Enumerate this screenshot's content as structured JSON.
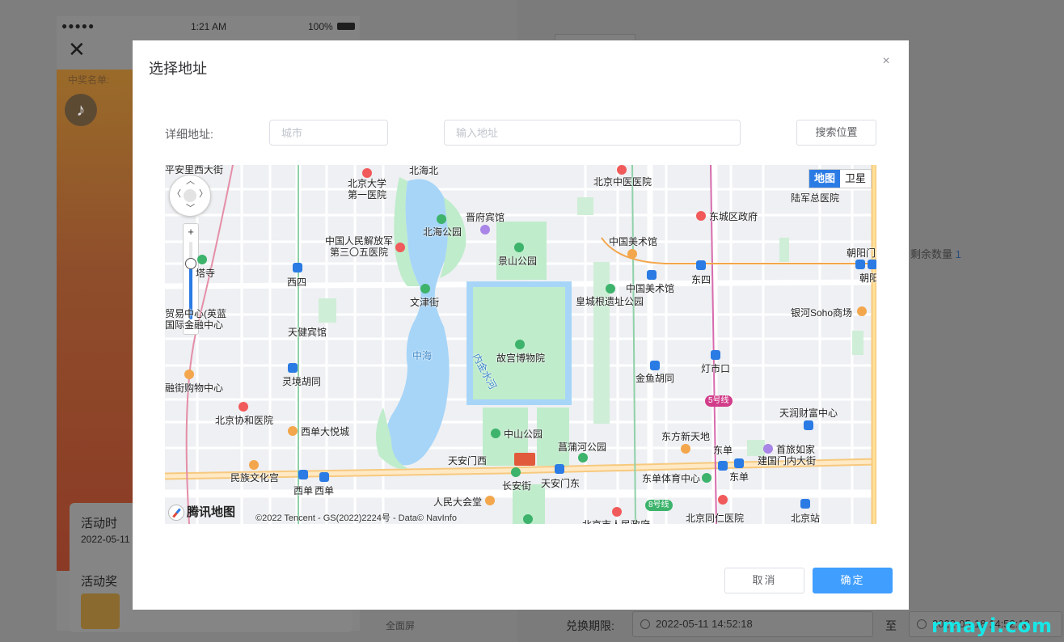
{
  "background": {
    "phone": {
      "signal": "●●●●●",
      "time": "1:21 AM",
      "battery": "100%",
      "notice": "中奖名单:",
      "card": {
        "activity_time_label": "活动时",
        "activity_time_value": "2022-05-11",
        "activity_prize_label": "活动奖"
      }
    },
    "fullscreen_label": "全面屏",
    "remaining_label": "剩余数量",
    "remaining_value": "1",
    "exchange_label": "兑换期限:",
    "exchange_start": "2022-05-11 14:52:18",
    "exchange_to": "至",
    "exchange_end": "2022-05-18 14:52:18",
    "watermark": "rmayi.com"
  },
  "dialog": {
    "title": "选择地址",
    "close_icon": "×",
    "address_label": "详细地址:",
    "city_placeholder": "城市",
    "address_placeholder": "输入地址",
    "search_button": "搜索位置",
    "cancel_button": "取消",
    "ok_button": "确定"
  },
  "map": {
    "toggle_map": "地图",
    "toggle_satellite": "卫星",
    "zoom_in": "+",
    "zoom_out": "−",
    "zoom_level": 0.72,
    "logo": "腾讯地图",
    "copyright": "©2022 Tencent - GS(2022)2224号 - Data© NavInfo",
    "places": {
      "pingan_li": "平安里西大街",
      "beida_hospital": "北京大学\n第一医院",
      "beihai_north": "北海北",
      "zhongyi_hospital": "北京中医医院",
      "luzong_hospital": "陆军总医院",
      "jinfu_hotel": "晋府宾馆",
      "beihai_park": "北海公园",
      "dongcheng_gov": "东城区政府",
      "pla_305": "中国人民解放军\n第三〇五医院",
      "jingshan_park": "景山公园",
      "art_museum": "中国美术馆",
      "art_museum_station": "中国美术馆",
      "chaoyangmen": "朝阳门",
      "chaoyangmen_short": "朝阳",
      "tower_temple": "塔寺",
      "xisi": "西四",
      "dongsi": "东四",
      "wenjin_street": "文津街",
      "huangcheng_park": "皇城根遗址公园",
      "yinhe_soho": "银河Soho商场",
      "trade_center": "贸易中心(英蓝\n国际金融中心",
      "tianjian_hotel": "天健宾馆",
      "zhonghai": "中海",
      "nei_jinshui": "内金水河",
      "forbidden_city": "故宫博物院",
      "dengshikou": "灯市口",
      "lingjing_hutong": "灵境胡同",
      "jinyu_hutong": "金鱼胡同",
      "finance_mall": "融街购物中心",
      "line5": "5号线",
      "xiehe_hospital": "北京协和医院",
      "xidan_joy": "西单大悦城",
      "zhongshan_park": "中山公园",
      "tianrun_center": "天润财富中心",
      "dongfang_plaza": "东方新天地",
      "changpu_park": "菖蒲河公园",
      "dongdan": "东单",
      "shoulu_home": "首旅如家",
      "tiananmen_west": "天安门西",
      "jianguomen_street": "建国门内大街",
      "minzu_palace": "民族文化宫",
      "changan_street": "长安街",
      "tiananmen_east": "天安门东",
      "dongdan_gym": "东单体育中心",
      "dongdan_station": "东单",
      "xidan_a": "西单",
      "xidan_b": "西单",
      "great_hall": "人民大会堂",
      "line8": "8号线",
      "tongren_hospital": "北京同仁医院",
      "beijing_station": "北京站",
      "beijing_gov": "北京市人民政府"
    }
  }
}
